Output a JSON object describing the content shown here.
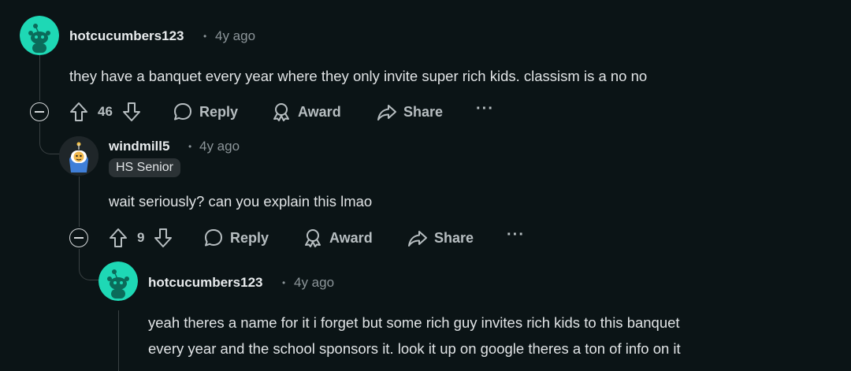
{
  "comments": [
    {
      "username": "hotcucumbers123",
      "time": "4y ago",
      "body": [
        "they have a banquet every year where they only invite super rich kids. classism is a no no"
      ],
      "score": "46",
      "reply_label": "Reply",
      "award_label": "Award",
      "share_label": "Share",
      "more_label": "···"
    },
    {
      "username": "windmill5",
      "time": "4y ago",
      "flair": "HS Senior",
      "body": [
        "wait seriously? can you explain this lmao"
      ],
      "score": "9",
      "reply_label": "Reply",
      "award_label": "Award",
      "share_label": "Share",
      "more_label": "···"
    },
    {
      "username": "hotcucumbers123",
      "time": "4y ago",
      "body": [
        "yeah theres a name for it i forget but some rich guy invites rich kids to this banquet",
        "every year and the school sponsors it. look it up on google theres a ton of info on it"
      ]
    }
  ],
  "separator": "•",
  "colors": {
    "background": "#0b1416",
    "avatar_teal": "#1ed8b5",
    "text": "#d7dadc",
    "muted": "#8c9599"
  },
  "icons": [
    "snoo-avatar-icon",
    "upvote-icon",
    "downvote-icon",
    "comment-bubble-icon",
    "award-icon",
    "share-arrow-icon",
    "collapse-icon"
  ]
}
